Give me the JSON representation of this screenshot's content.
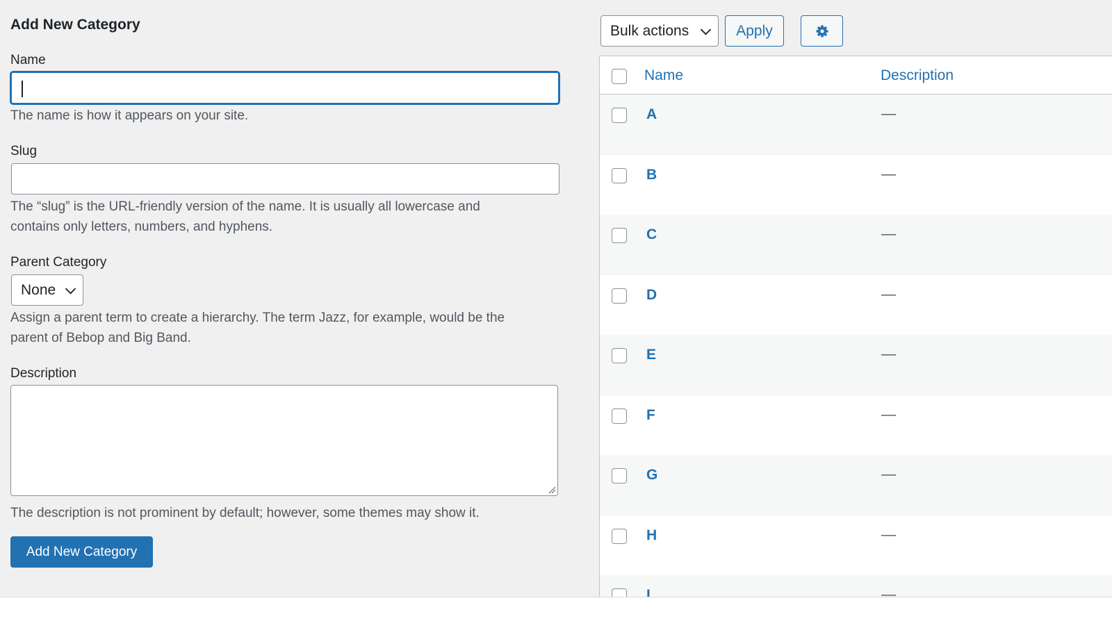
{
  "form": {
    "title": "Add New Category",
    "name_label": "Name",
    "name_value": "",
    "name_help": "The name is how it appears on your site.",
    "slug_label": "Slug",
    "slug_value": "",
    "slug_help_line1": "The “slug” is the URL-friendly version of the name. It is usually all lowercase and",
    "slug_help_line2": "contains only letters, numbers, and hyphens.",
    "parent_label": "Parent Category",
    "parent_selected": "None",
    "parent_help_line1": "Assign a parent term to create a hierarchy. The term Jazz, for example, would be the",
    "parent_help_line2": "parent of Bebop and Big Band.",
    "description_label": "Description",
    "description_value": "",
    "description_help": "The description is not prominent by default; however, some themes may show it.",
    "submit_label": "Add New Category"
  },
  "toolbar": {
    "bulk_actions_label": "Bulk actions",
    "apply_label": "Apply",
    "settings_icon": "gear-icon"
  },
  "table": {
    "columns": {
      "name": "Name",
      "description": "Description"
    },
    "rows": [
      {
        "name": "A",
        "description": "—"
      },
      {
        "name": "B",
        "description": "—"
      },
      {
        "name": "C",
        "description": "—"
      },
      {
        "name": "D",
        "description": "—"
      },
      {
        "name": "E",
        "description": "—"
      },
      {
        "name": "F",
        "description": "—"
      },
      {
        "name": "G",
        "description": "—"
      },
      {
        "name": "H",
        "description": "—"
      },
      {
        "name": "I",
        "description": "—"
      }
    ]
  },
  "colors": {
    "accent": "#2271b1",
    "page_background": "#f0f0f1",
    "text": "#1d2327",
    "help_text": "#50575e"
  }
}
